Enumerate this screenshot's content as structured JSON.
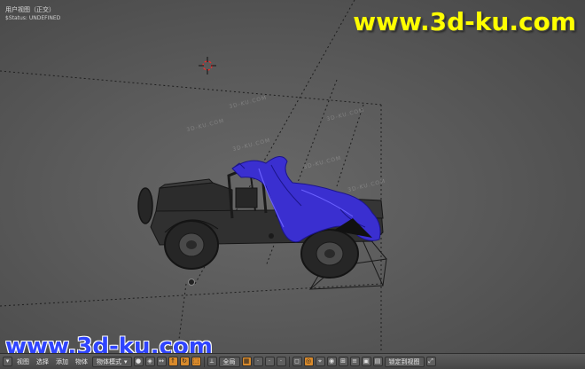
{
  "viewport": {
    "title": "用户视图（正交）",
    "status": "$Status: UNDEFINED"
  },
  "watermarks": {
    "top": "www.3d-ku.com",
    "bottom": "www.3d-ku.com",
    "faint": "3D-KU.COM"
  },
  "header": {
    "menus": [
      "视图",
      "选择",
      "添加",
      "物体"
    ],
    "mode_label": "物体模式",
    "layer_value": "全局",
    "lock_label": "锁定到视图"
  },
  "colors": {
    "viewport_bg": "#5a5a5a",
    "cloth": "#3a2fd0",
    "accent_orange": "#d98a2b",
    "watermark_yellow": "#ffff00",
    "watermark_blue": "#2f44ff"
  },
  "icons": [
    "3d-cursor-icon",
    "camera-icon",
    "view-menu-icon",
    "pivot-icon",
    "snap-icon",
    "render-icon"
  ]
}
